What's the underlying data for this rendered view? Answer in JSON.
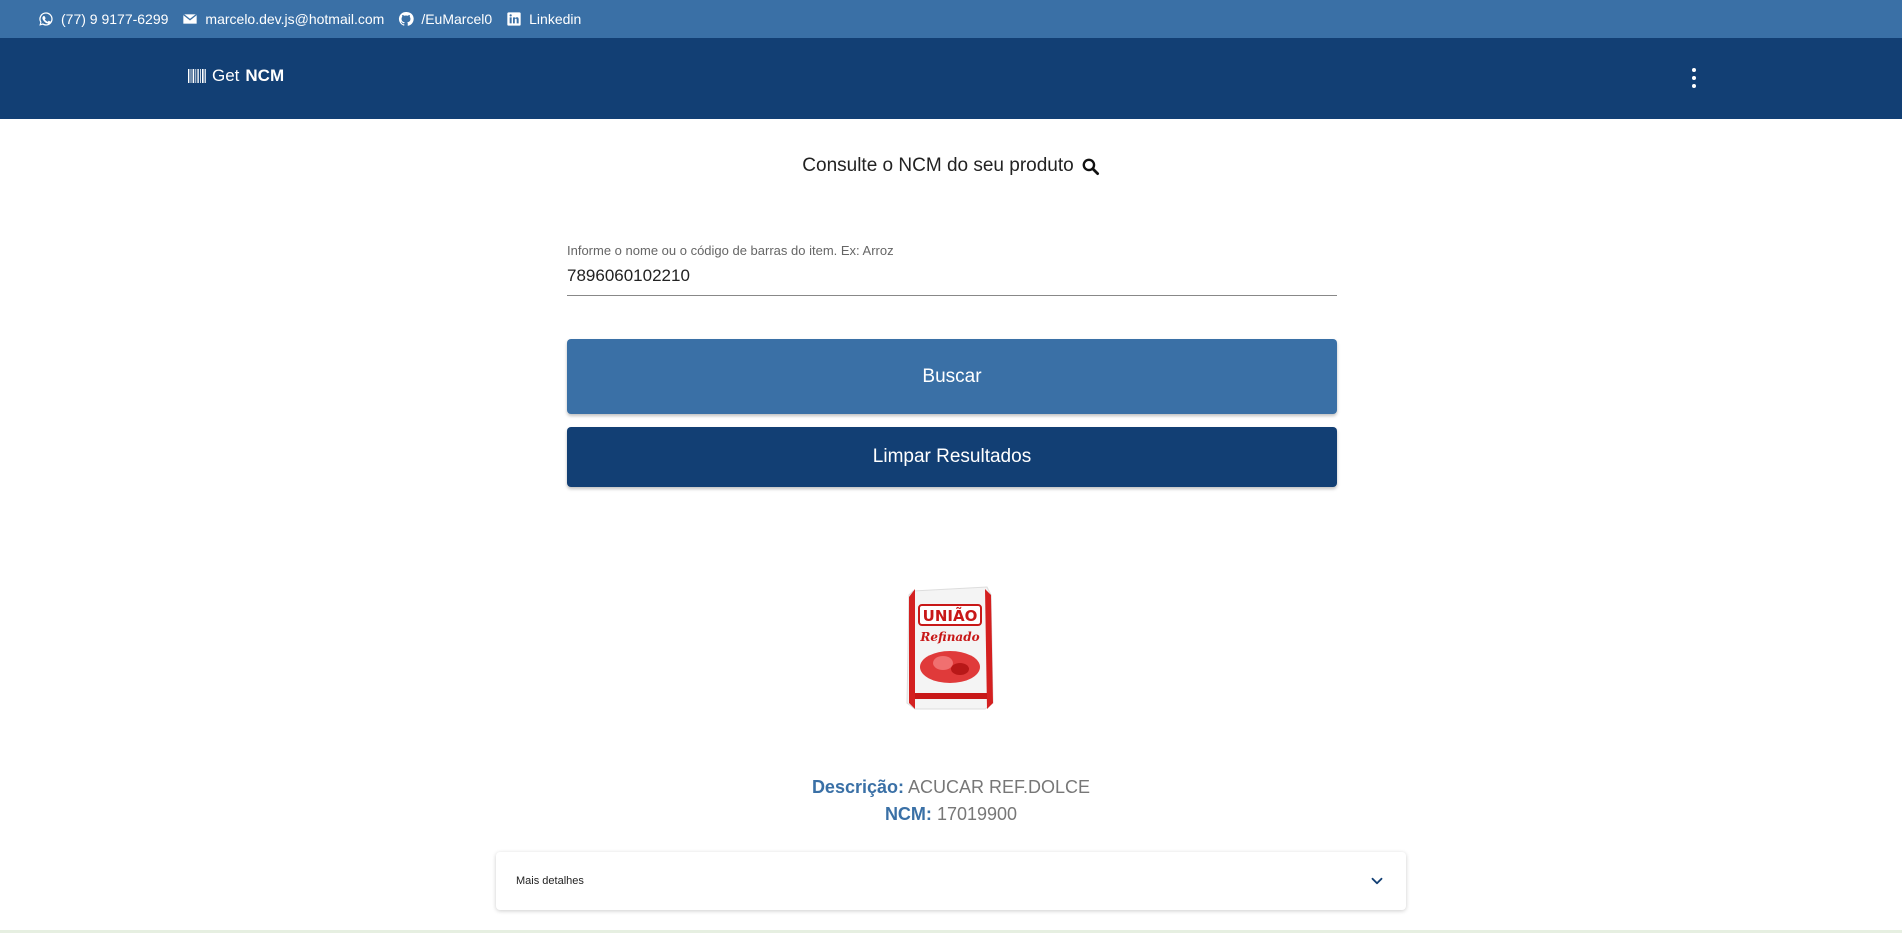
{
  "topbar": {
    "phone": "(77) 9 9177-6299",
    "email": "marcelo.dev.js@hotmail.com",
    "github": "/EuMarcel0",
    "linkedin": "Linkedin"
  },
  "header": {
    "logo_prefix": "Get",
    "logo_bold": "NCM",
    "menu_icon": "more-vertical-icon"
  },
  "main": {
    "title": "Consulte o NCM do seu produto",
    "search_label": "Informe o nome ou o código de barras do item. Ex: Arroz",
    "search_value": "7896060102210",
    "search_button": "Buscar",
    "clear_button": "Limpar Resultados"
  },
  "result": {
    "brand_text": "UNIÃO",
    "product_text": "Refinado",
    "description_label": "Descrição:",
    "description_value": "ACUCAR REF.DOLCE",
    "ncm_label": "NCM:",
    "ncm_value": "17019900",
    "details_label": "Mais detalhes"
  },
  "colors": {
    "topbar": "#3a70a6",
    "header": "#123f74",
    "accent": "#3a70a6"
  }
}
